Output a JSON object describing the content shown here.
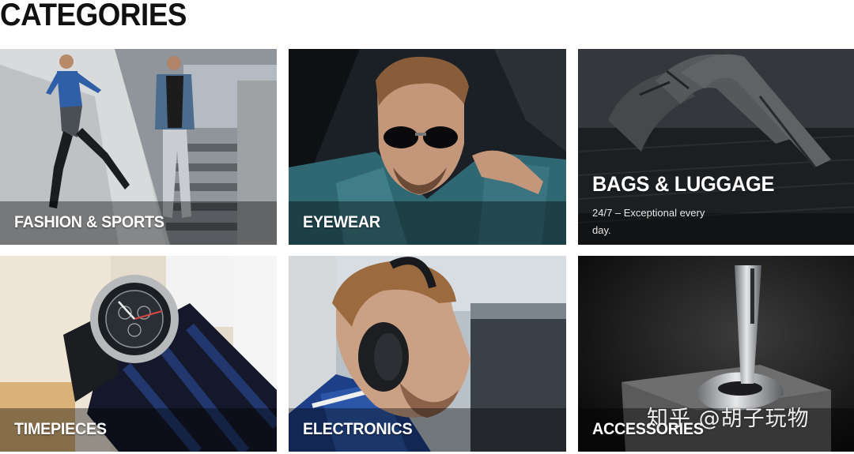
{
  "page": {
    "title": "CATEGORIES"
  },
  "categories": [
    {
      "label": "FASHION & SPORTS",
      "description": ""
    },
    {
      "label": "EYEWEAR",
      "description": ""
    },
    {
      "label": "BAGS & LUGGAGE",
      "description": "24/7 – Exceptional every day."
    },
    {
      "label": "TIMEPIECES",
      "description": ""
    },
    {
      "label": "ELECTRONICS",
      "description": ""
    },
    {
      "label": "ACCESSORIES",
      "description": ""
    }
  ],
  "watermark": {
    "text": "知乎 @胡子玩物"
  },
  "icons": [
    "runner-photo",
    "man-sunglasses-photo",
    "bag-photo",
    "watch-photo",
    "headphones-photo",
    "pen-photo"
  ]
}
